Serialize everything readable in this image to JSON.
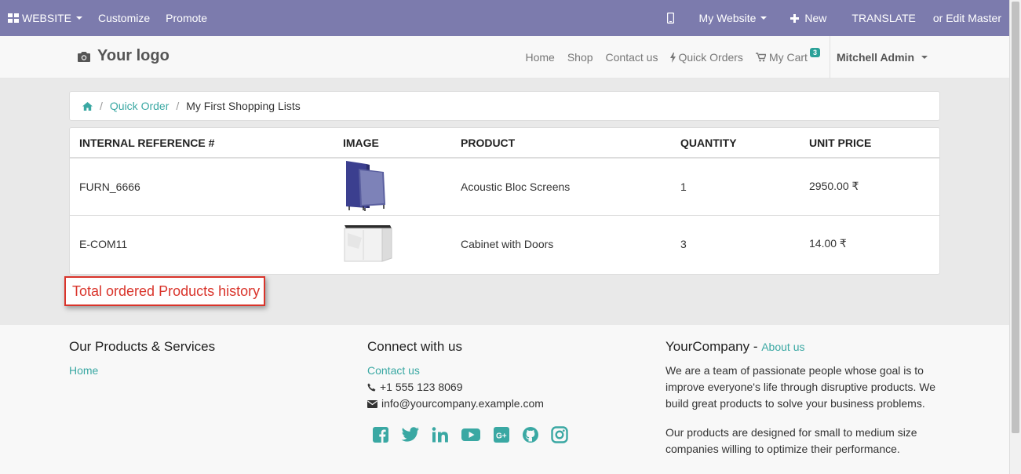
{
  "adminbar": {
    "website_menu": "WEBSITE",
    "customize": "Customize",
    "promote": "Promote",
    "my_website": "My Website",
    "new": "New",
    "translate": "TRANSLATE",
    "edit_master": "or Edit Master"
  },
  "header": {
    "logo": "Your logo",
    "nav": {
      "home": "Home",
      "shop": "Shop",
      "contact": "Contact us",
      "quick_orders": "Quick Orders",
      "cart": "My Cart",
      "cart_count": "3",
      "user": "Mitchell Admin"
    }
  },
  "breadcrumb": {
    "quick_order": "Quick Order",
    "current": "My First Shopping Lists"
  },
  "table": {
    "headers": {
      "ref": "INTERNAL REFERENCE #",
      "image": "IMAGE",
      "product": "PRODUCT",
      "quantity": "QUANTITY",
      "price": "UNIT PRICE"
    },
    "rows": [
      {
        "ref": "FURN_6666",
        "product": "Acoustic Bloc Screens",
        "quantity": "1",
        "price": "2950.00 ₹"
      },
      {
        "ref": "E-COM11",
        "product": "Cabinet with Doors",
        "quantity": "3",
        "price": "14.00 ₹"
      }
    ]
  },
  "callout": "Total ordered Products history",
  "footer": {
    "col1": {
      "title": "Our Products & Services",
      "home": "Home"
    },
    "col2": {
      "title": "Connect with us",
      "contact": "Contact us",
      "phone": "+1 555 123 8069",
      "email": "info@yourcompany.example.com"
    },
    "col3": {
      "company": "YourCompany",
      "dash": " - ",
      "about": "About us",
      "p1": "We are a team of passionate people whose goal is to improve everyone's life through disruptive products. We build great products to solve your business problems.",
      "p2": "Our products are designed for small to medium size companies willing to optimize their performance."
    }
  },
  "colors": {
    "adminbar": "#7c7bad",
    "accent": "#3aa8a3",
    "callout": "#d9342b"
  }
}
